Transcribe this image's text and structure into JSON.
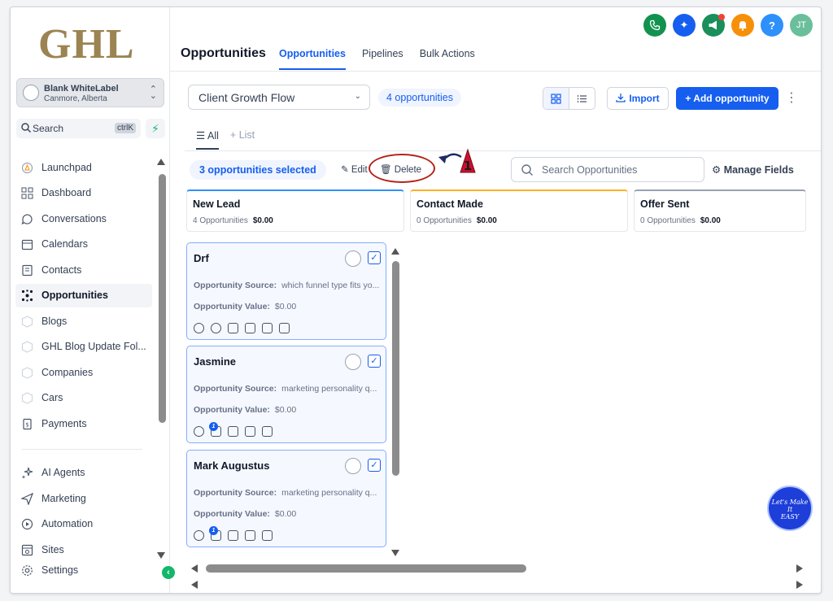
{
  "sidebar": {
    "logo": "GHL",
    "location": {
      "name": "Blank WhiteLabel",
      "place": "Canmore, Alberta"
    },
    "search": {
      "label": "Search",
      "shortcut": "ctrlK"
    },
    "items": [
      {
        "label": "Launchpad",
        "icon": "rocket-icon"
      },
      {
        "label": "Dashboard",
        "icon": "grid-icon"
      },
      {
        "label": "Conversations",
        "icon": "chat-icon"
      },
      {
        "label": "Calendars",
        "icon": "calendar-icon"
      },
      {
        "label": "Contacts",
        "icon": "contacts-icon"
      },
      {
        "label": "Opportunities",
        "icon": "opportunities-icon",
        "active": true
      },
      {
        "label": "Blogs",
        "icon": "cube-icon"
      },
      {
        "label": "GHL Blog Update Fol...",
        "icon": "cube-icon"
      },
      {
        "label": "Companies",
        "icon": "cube-icon"
      },
      {
        "label": "Cars",
        "icon": "cube-icon"
      },
      {
        "label": "Payments",
        "icon": "payments-icon"
      }
    ],
    "items2": [
      {
        "label": "AI Agents",
        "icon": "sparkle-icon"
      },
      {
        "label": "Marketing",
        "icon": "send-icon"
      },
      {
        "label": "Automation",
        "icon": "automation-icon"
      },
      {
        "label": "Sites",
        "icon": "sites-icon"
      },
      {
        "label": "Settings",
        "icon": "settings-icon"
      }
    ]
  },
  "header": {
    "title": "Opportunities",
    "tabs": [
      "Opportunities",
      "Pipelines",
      "Bulk Actions"
    ],
    "avatar": "JT",
    "help": "?",
    "icon_colors": [
      "#12924f",
      "#155eef",
      "#1a8f5a",
      "#f79009",
      "#2e90fa",
      "#6abf9a"
    ]
  },
  "toolbar": {
    "pipeline": "Client Growth Flow",
    "count": "4 opportunities",
    "import": "Import",
    "add": "+ Add opportunity",
    "view_all": "All",
    "view_list": "List",
    "selected": "3 opportunities selected",
    "edit": "Edit",
    "delete": "Delete",
    "search_placeholder": "Search Opportunities",
    "manage_fields": "Manage Fields",
    "annotation_number": "1"
  },
  "columns": [
    {
      "name": "New Lead",
      "count": "4 Opportunities",
      "value": "$0.00",
      "accent": "#2e90fa"
    },
    {
      "name": "Contact Made",
      "count": "0 Opportunities",
      "value": "$0.00",
      "accent": "#fdb022"
    },
    {
      "name": "Offer Sent",
      "count": "0 Opportunities",
      "value": "$0.00",
      "accent": "#98a2b3"
    }
  ],
  "cards": [
    {
      "name": "Drf",
      "source_label": "Opportunity Source:",
      "source": "which funnel type fits yo...",
      "value_label": "Opportunity Value:",
      "value": "$0.00"
    },
    {
      "name": "Jasmine",
      "source_label": "Opportunity Source:",
      "source": "marketing personality q...",
      "value_label": "Opportunity Value:",
      "value": "$0.00",
      "badge": "1"
    },
    {
      "name": "Mark Augustus",
      "source_label": "Opportunity Source:",
      "source": "marketing personality q...",
      "value_label": "Opportunity Value:",
      "value": "$0.00",
      "badge": "1"
    }
  ],
  "watermark": "Let's Make It EASY"
}
